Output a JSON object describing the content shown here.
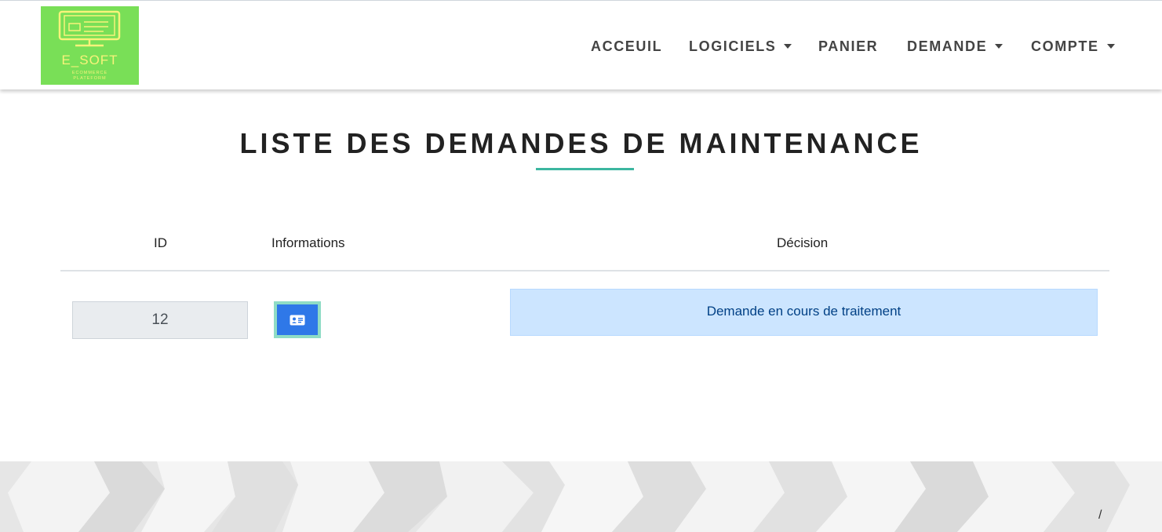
{
  "brand": {
    "name": "E_SOFT",
    "tagline_line1": "ECOMMERCE",
    "tagline_line2": "PLATEFORM",
    "bg_color": "#79df57",
    "fg_color": "#f7f37a",
    "icon": "monitor-icon"
  },
  "nav": {
    "items": [
      {
        "label": "ACCEUIL",
        "dropdown": false
      },
      {
        "label": "LOGICIELS",
        "dropdown": true
      },
      {
        "label": "PANIER",
        "dropdown": false
      },
      {
        "label": "DEMANDE",
        "dropdown": true
      },
      {
        "label": "COMPTE",
        "dropdown": true
      }
    ]
  },
  "page": {
    "title": "LISTE DES DEMANDES DE MAINTENANCE",
    "accent_color": "#3cb6a0"
  },
  "table": {
    "headers": {
      "id": "ID",
      "informations": "Informations",
      "decision": "Décision"
    },
    "rows": [
      {
        "id": "12",
        "info_icon": "id-card-icon",
        "decision": "Demande en cours de traitement"
      }
    ]
  },
  "footer": {
    "text": "/"
  }
}
